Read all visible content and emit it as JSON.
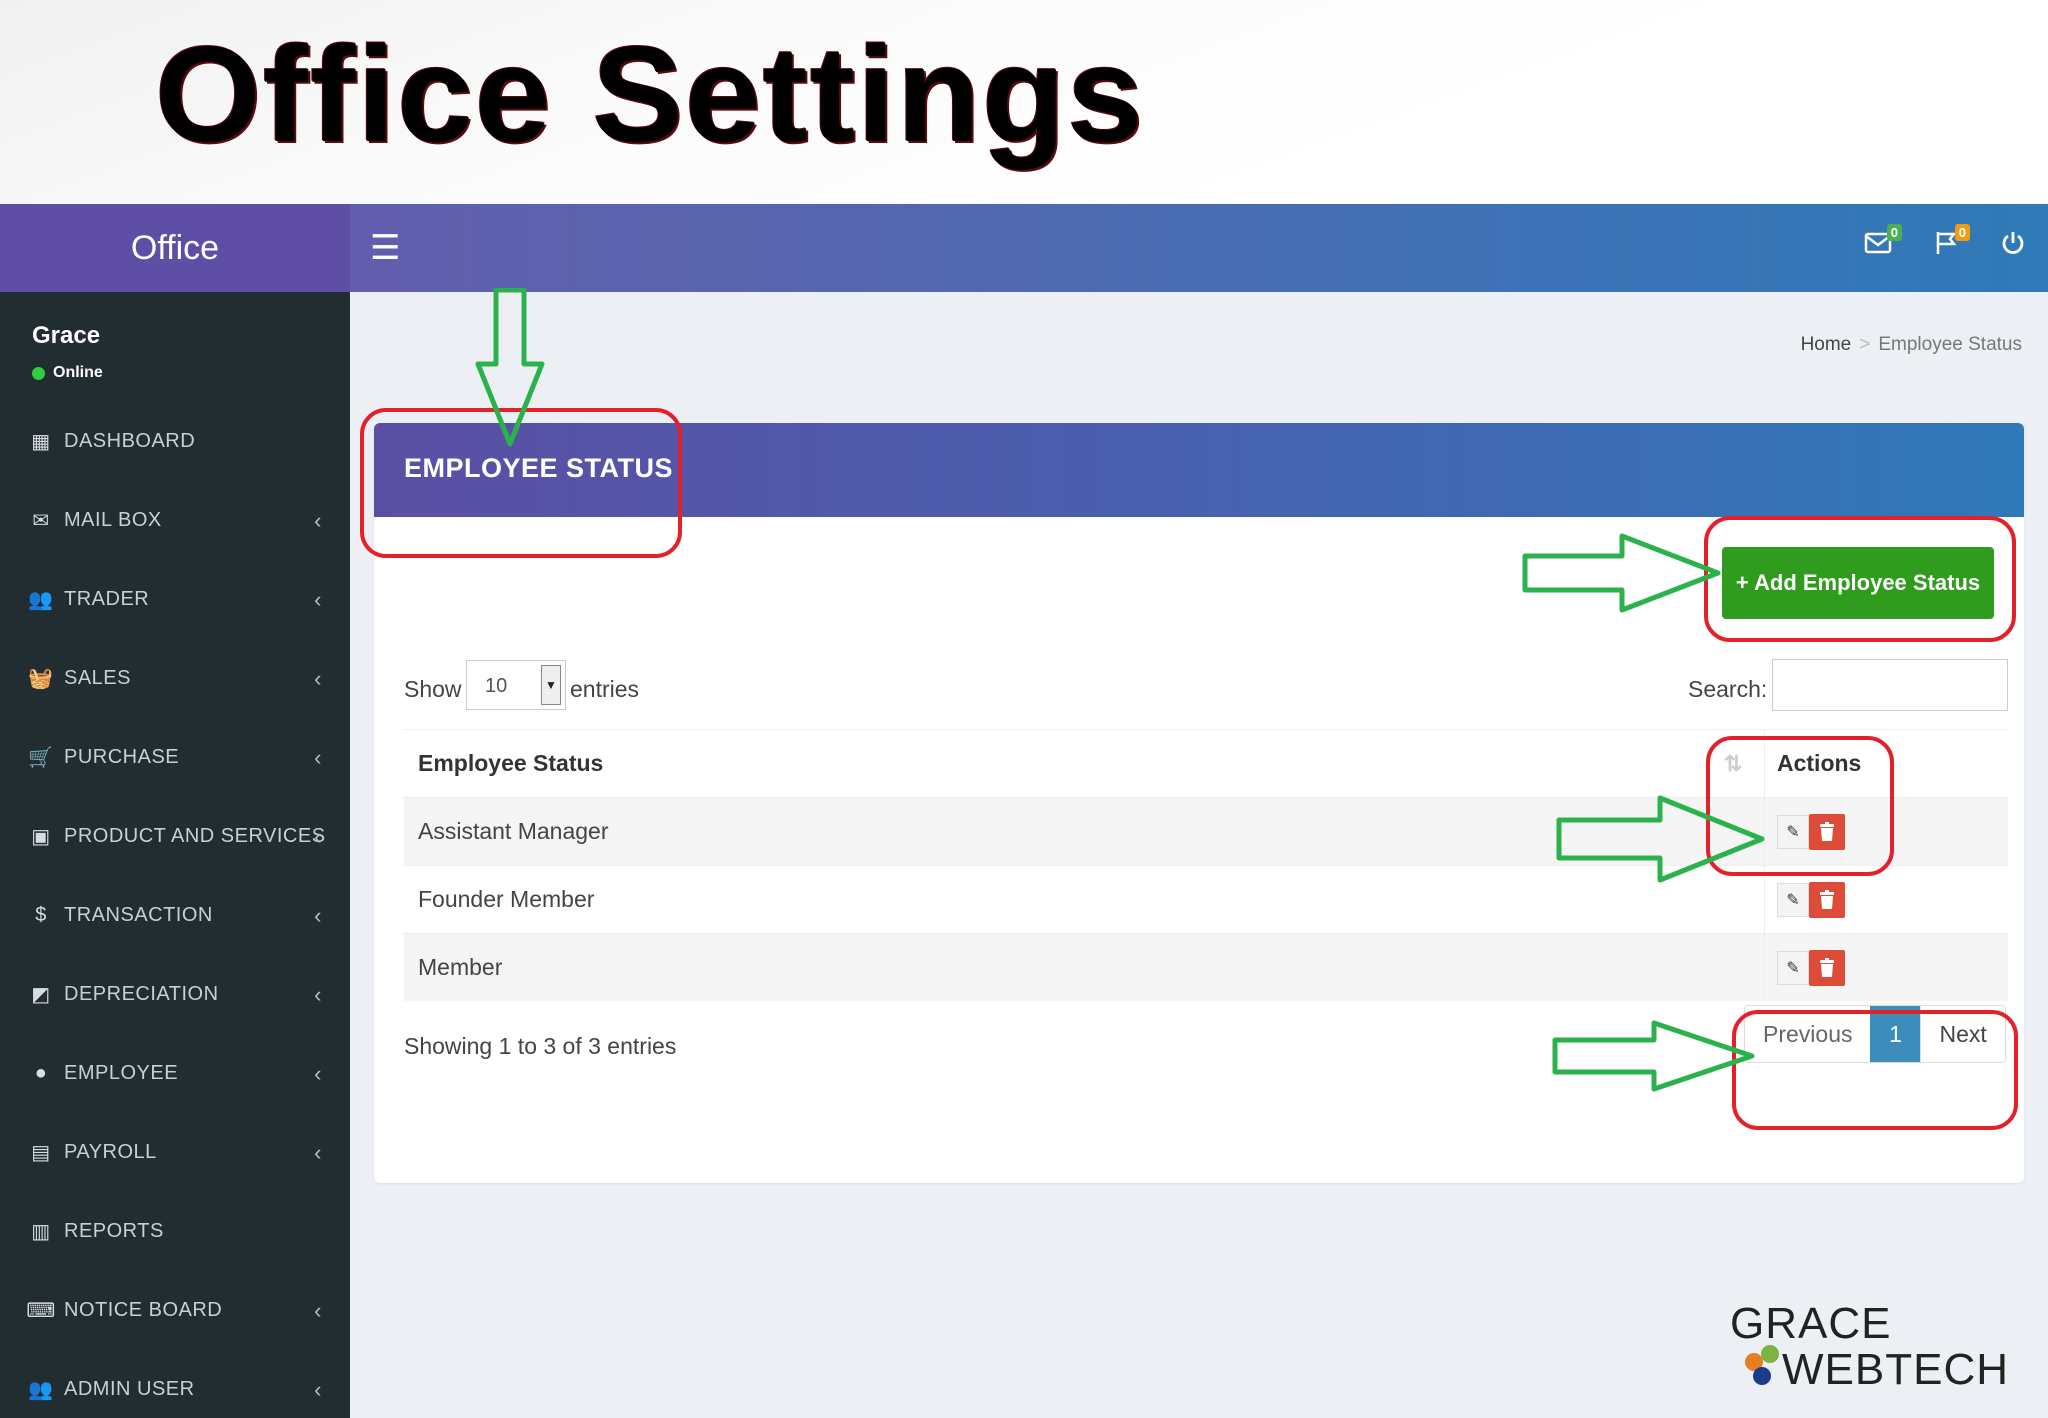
{
  "slide": {
    "title": "Office Settings"
  },
  "app": {
    "brand": "Office",
    "topbar": {
      "mail_badge": "0",
      "flag_badge": "0",
      "colors": {
        "mail_badge": "#4caf50",
        "flag_badge": "#f39c12"
      }
    },
    "user": {
      "name": "Grace",
      "status": "Online"
    },
    "nav": [
      {
        "label": "DASHBOARD",
        "icon": "dashboard-icon",
        "has_submenu": false
      },
      {
        "label": "MAIL BOX",
        "icon": "mail-icon",
        "has_submenu": true
      },
      {
        "label": "TRADER",
        "icon": "users-icon",
        "has_submenu": true
      },
      {
        "label": "SALES",
        "icon": "basket-icon",
        "has_submenu": true
      },
      {
        "label": "PURCHASE",
        "icon": "cart-icon",
        "has_submenu": true
      },
      {
        "label": "PRODUCT AND SERVICES",
        "icon": "archive-icon",
        "has_submenu": true
      },
      {
        "label": "TRANSACTION",
        "icon": "money-icon",
        "has_submenu": true
      },
      {
        "label": "DEPRECIATION",
        "icon": "calculator-icon",
        "has_submenu": true
      },
      {
        "label": "EMPLOYEE",
        "icon": "user-circle-icon",
        "has_submenu": true
      },
      {
        "label": "PAYROLL",
        "icon": "wallet-icon",
        "has_submenu": true
      },
      {
        "label": "REPORTS",
        "icon": "clipboard-icon",
        "has_submenu": false
      },
      {
        "label": "NOTICE BOARD",
        "icon": "keyboard-icon",
        "has_submenu": true
      },
      {
        "label": "ADMIN USER",
        "icon": "group-icon",
        "has_submenu": true
      }
    ],
    "breadcrumb": {
      "home": "Home",
      "current": "Employee Status"
    },
    "panel": {
      "title": "EMPLOYEE STATUS",
      "add_button": "+ Add Employee Status",
      "show_label": "Show",
      "page_size": "10",
      "entries_label": "entries",
      "search_label": "Search:",
      "search_value": "",
      "columns": [
        "Employee Status",
        "Actions"
      ],
      "rows": [
        "Assistant Manager",
        "Founder Member",
        "Member"
      ],
      "info": "Showing 1 to 3 of 3 entries",
      "pagination": {
        "previous": "Previous",
        "current": "1",
        "next": "Next"
      }
    },
    "colors": {
      "add_button": "#2f9c1e",
      "delete_button": "#dd4b39",
      "pagination_active": "#3c8dbc",
      "sidebar": "#222d32",
      "annotation_ring": "#e3212a",
      "annotation_arrow": "#2bb24c"
    }
  },
  "logo": {
    "line1": "GRACE",
    "line2": "WEBTECH"
  }
}
